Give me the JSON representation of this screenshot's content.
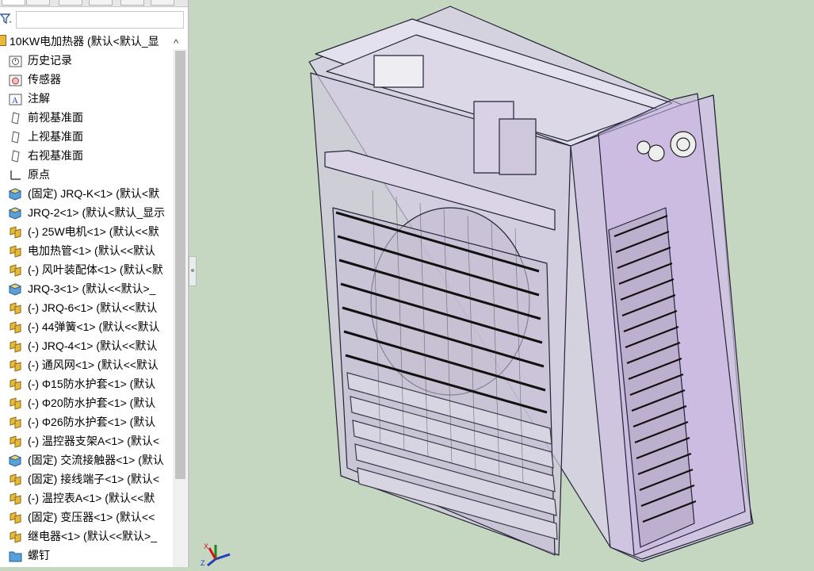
{
  "feature_tree": {
    "root": "10KW电加热器 (默认<默认_显",
    "items": [
      {
        "label": "历史记录",
        "icon": "history-icon"
      },
      {
        "label": "传感器",
        "icon": "sensor-icon"
      },
      {
        "label": "注解",
        "icon": "annotation-icon"
      },
      {
        "label": "前视基准面",
        "icon": "plane-icon"
      },
      {
        "label": "上视基准面",
        "icon": "plane-icon"
      },
      {
        "label": "右视基准面",
        "icon": "plane-icon"
      },
      {
        "label": "原点",
        "icon": "origin-icon"
      },
      {
        "label": "(固定) JRQ-K<1> (默认<默",
        "icon": "part-icon"
      },
      {
        "label": "JRQ-2<1> (默认<默认_显示",
        "icon": "part-icon"
      },
      {
        "label": "(-) 25W电机<1> (默认<<默",
        "icon": "assembly-icon"
      },
      {
        "label": "电加热管<1> (默认<<默认",
        "icon": "assembly-icon"
      },
      {
        "label": "(-) 风叶装配体<1> (默认<默",
        "icon": "assembly-icon"
      },
      {
        "label": "JRQ-3<1> (默认<<默认>_",
        "icon": "part-icon"
      },
      {
        "label": "(-) JRQ-6<1> (默认<<默认",
        "icon": "assembly-icon"
      },
      {
        "label": "(-) 44弹簧<1> (默认<<默认",
        "icon": "assembly-icon"
      },
      {
        "label": "(-) JRQ-4<1> (默认<<默认",
        "icon": "assembly-icon"
      },
      {
        "label": "(-) 通风网<1> (默认<<默认",
        "icon": "assembly-icon"
      },
      {
        "label": "(-) Φ15防水护套<1> (默认",
        "icon": "assembly-icon"
      },
      {
        "label": "(-) Φ20防水护套<1> (默认",
        "icon": "assembly-icon"
      },
      {
        "label": "(-) Φ26防水护套<1> (默认",
        "icon": "assembly-icon"
      },
      {
        "label": "(-) 温控器支架A<1> (默认<",
        "icon": "assembly-icon"
      },
      {
        "label": "(固定) 交流接触器<1> (默认",
        "icon": "part-icon"
      },
      {
        "label": "(固定) 接线端子<1> (默认<",
        "icon": "assembly-icon"
      },
      {
        "label": "(-) 温控表A<1> (默认<<默",
        "icon": "assembly-icon"
      },
      {
        "label": "(固定) 变压器<1> (默认<<",
        "icon": "assembly-icon"
      },
      {
        "label": "继电器<1> (默认<<默认>_",
        "icon": "assembly-icon"
      },
      {
        "label": "螺钉",
        "icon": "folder-icon"
      }
    ]
  },
  "viewport": {
    "background": "#c5d7c0",
    "triad_labels": {
      "x": "X",
      "z": "Z"
    }
  },
  "colors": {
    "part_icon": "#5aa0d8",
    "assembly_icon": "#e6b93c",
    "model_edge": "#232336",
    "model_fill": "#d6d0e4"
  }
}
